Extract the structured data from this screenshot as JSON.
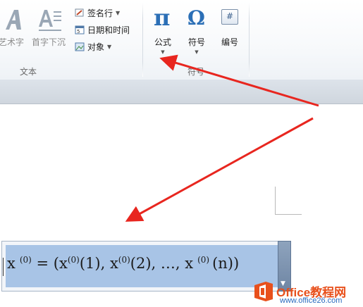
{
  "ribbon": {
    "text_group": {
      "label": "文本",
      "wordart_label": "艺术字",
      "dropcap_label": "首字下沉",
      "signature_label": "签名行",
      "datetime_label": "日期和时间",
      "object_label": "对象"
    },
    "symbols_group": {
      "label": "符号",
      "equation_glyph": "π",
      "equation_label": "公式",
      "symbol_glyph": "Ω",
      "symbol_label": "符号",
      "number_glyph": "#",
      "number_label": "编号"
    }
  },
  "equation": {
    "lhs_var": "x",
    "lhs_sup": "(0)",
    "equals": "= (",
    "t1_var": "x",
    "t1_sup": "(0)",
    "t1_arg": "(1), ",
    "t2_var": "x",
    "t2_sup": "(0)",
    "t2_arg": "(2), …, ",
    "t3_var": "x",
    "t3_sup": "(0)",
    "t3_arg": "(n))"
  },
  "watermark": {
    "title": "Office教程网",
    "url": "www.office26.com"
  },
  "colors": {
    "accent": "#2b6fb6",
    "selection": "#a8c4e6",
    "arrow": "#e8261f",
    "watermark": "#e8501c"
  }
}
